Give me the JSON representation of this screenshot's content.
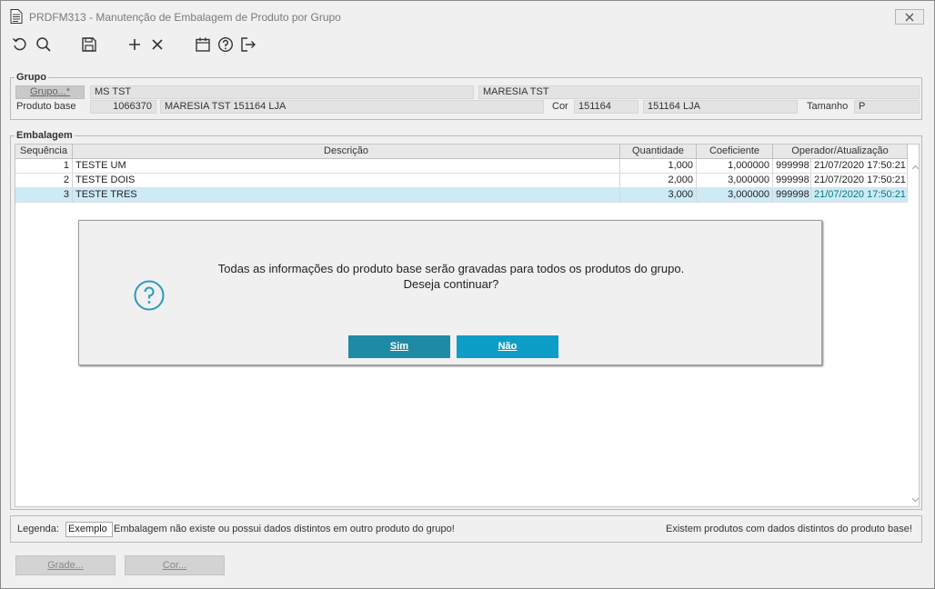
{
  "window": {
    "title": "PRDFM313 - Manutenção de Embalagem de Produto por Grupo"
  },
  "toolbar": {
    "icons": [
      "undo-icon",
      "search-icon",
      "save-icon",
      "add-icon",
      "delete-icon",
      "calendar-icon",
      "help-icon",
      "exit-icon"
    ]
  },
  "grupo": {
    "section_title": "Grupo",
    "grupo_button": "Grupo...*",
    "grupo_code": "MS TST",
    "grupo_desc": "MARESIA TST",
    "produto_base_label": "Produto base",
    "produto_base_code": "1066370",
    "produto_base_desc": "MARESIA TST 151164 LJA",
    "cor_label": "Cor",
    "cor_code": "151164",
    "cor_desc": "151164 LJA",
    "tamanho_label": "Tamanho",
    "tamanho_value": "P"
  },
  "embalagem": {
    "section_title": "Embalagem",
    "columns": [
      "Sequência",
      "Descrição",
      "Quantidade",
      "Coeficiente",
      "Operador/Atualização"
    ],
    "rows": [
      {
        "seq": "1",
        "desc": "TESTE UM",
        "qty": "1,000",
        "coef": "1,000000",
        "op": "999998",
        "date": "21/07/2020 17:50:21"
      },
      {
        "seq": "2",
        "desc": "TESTE DOIS",
        "qty": "2,000",
        "coef": "3,000000",
        "op": "999998",
        "date": "21/07/2020 17:50:21"
      },
      {
        "seq": "3",
        "desc": "TESTE TRES",
        "qty": "3,000",
        "coef": "3,000000",
        "op": "999998",
        "date": "21/07/2020 17:50:21"
      }
    ],
    "selected_row": 3
  },
  "dialog": {
    "message_line1": "Todas as informações do produto base serão gravadas para todos os produtos do grupo.",
    "message_line2": "Deseja continuar?",
    "yes_label": "Sim",
    "no_label": "Não",
    "icon": "question-icon"
  },
  "legend": {
    "label": "Legenda:",
    "example": "Exemplo",
    "example_text": "Embalagem não existe ou possui dados distintos em outro produto do grupo!",
    "right_text": "Existem produtos com dados distintos do produto base!"
  },
  "footer": {
    "grade_label": "Grade...",
    "cor_label": "Cor..."
  },
  "colors": {
    "selected_row": "#cdeaf7",
    "dialog_button_yes": "#1e8aa6",
    "dialog_button_no": "#0e9dc7",
    "question_icon": "#2a9ac0"
  }
}
